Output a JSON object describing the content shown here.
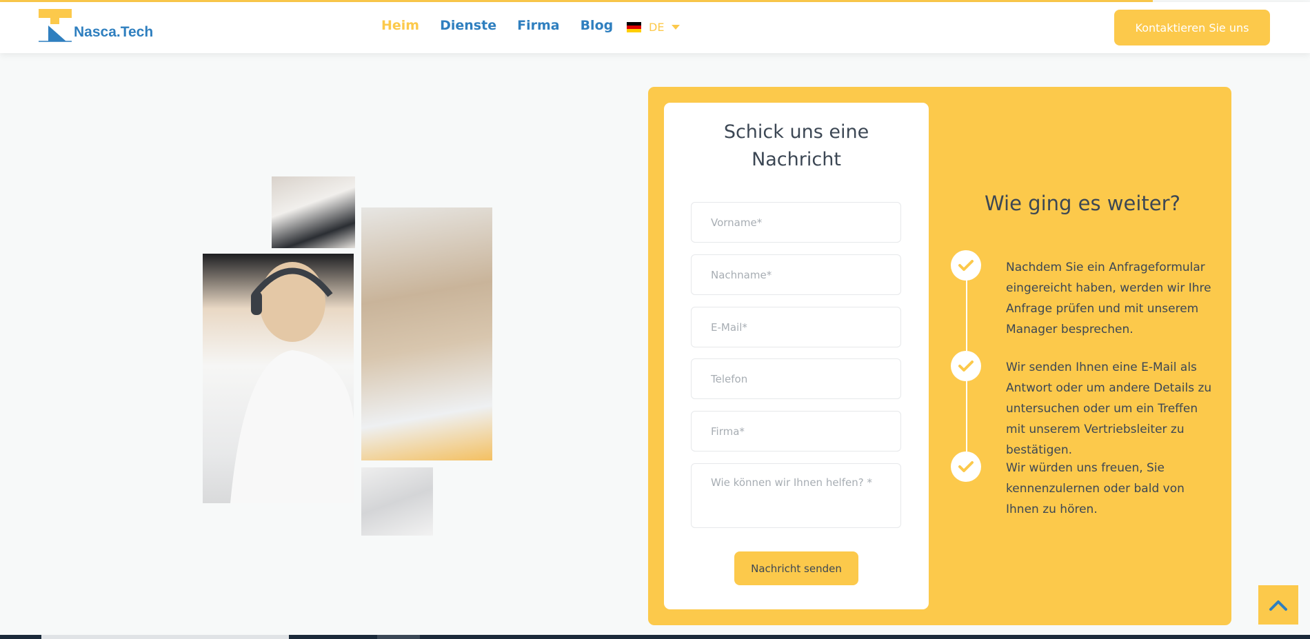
{
  "progress": {
    "fraction": 0.88
  },
  "header": {
    "brand": "Nasca.Tech",
    "nav": [
      {
        "label": "Heim",
        "active": true
      },
      {
        "label": "Dienste",
        "active": false
      },
      {
        "label": "Firma",
        "active": false
      },
      {
        "label": "Blog",
        "active": false
      }
    ],
    "language": {
      "code": "DE",
      "flag": "germany-flag-icon"
    },
    "cta_label": "Kontaktieren Sie uns"
  },
  "form": {
    "title_line1": "Schick uns eine",
    "title_line2": "Nachricht",
    "fields": {
      "first_name": "Vorname*",
      "last_name": "Nachname*",
      "email": "E-Mail*",
      "phone": "Telefon",
      "company": "Firma*",
      "message": "Wie können wir Ihnen helfen? *"
    },
    "submit_label": "Nachricht senden"
  },
  "next_steps": {
    "title": "Wie ging es weiter?",
    "items": [
      {
        "icon": "check-icon",
        "text": "Nachdem Sie ein Anfrageformular eingereicht haben, werden wir Ihre Anfrage prüfen und mit unserem Manager besprechen."
      },
      {
        "icon": "check-icon",
        "text": "Wir senden Ihnen eine E-Mail als Antwort oder um andere Details zu untersuchen oder um ein Treffen mit unserem Vertriebsleiter zu bestätigen."
      },
      {
        "icon": "check-icon",
        "text": "Wir würden uns freuen, Sie kennenzulernen oder bald von Ihnen zu hören."
      }
    ]
  },
  "colors": {
    "accent": "#fcc94b",
    "brand_blue": "#2f7fbf",
    "text_dark": "#3c4754"
  },
  "icons": {
    "back_to_top": "chevron-up-icon",
    "language_caret": "caret-down-icon"
  }
}
